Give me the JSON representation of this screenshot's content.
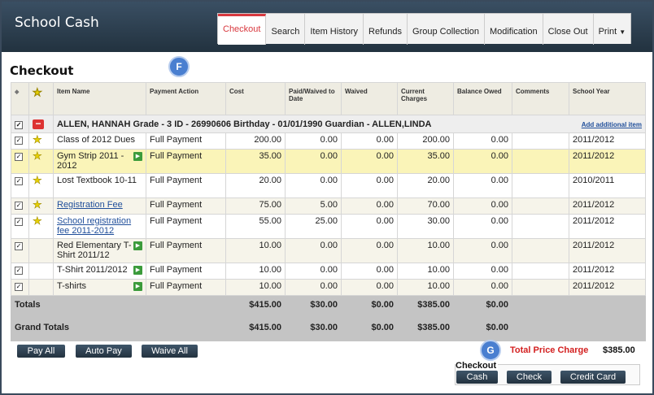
{
  "app": {
    "title": "School Cash"
  },
  "tabs": [
    {
      "label": "Checkout",
      "active": true
    },
    {
      "label": "Search"
    },
    {
      "label": "Item History"
    },
    {
      "label": "Refunds"
    },
    {
      "label": "Group Collection"
    },
    {
      "label": "Modification"
    },
    {
      "label": "Close Out"
    },
    {
      "label": "Print"
    }
  ],
  "page": {
    "title": "Checkout"
  },
  "markers": {
    "f": "F",
    "g": "G"
  },
  "columns": [
    "Item Name",
    "Payment Action",
    "Cost",
    "Paid/Waived to Date",
    "Waived",
    "Current Charges",
    "Balance Owed",
    "Comments",
    "School Year"
  ],
  "student": {
    "label": "ALLEN, HANNAH Grade - 3 ID - 26990606 Birthday - 01/01/1990 Guardian - ALLEN,LINDA",
    "add_link": "Add additional item"
  },
  "rows": [
    {
      "star": true,
      "name": "Class of 2012 Dues",
      "link": false,
      "action": "Full Payment",
      "cost": "200.00",
      "paid": "0.00",
      "waived": "0.00",
      "current": "200.00",
      "balance": "0.00",
      "comments": "",
      "year": "2011/2012"
    },
    {
      "star": true,
      "name": "Gym Strip 2011 - 2012",
      "link": false,
      "action": "Full Payment",
      "cost": "35.00",
      "paid": "0.00",
      "waived": "0.00",
      "current": "35.00",
      "balance": "0.00",
      "comments": "",
      "year": "2011/2012"
    },
    {
      "star": true,
      "name": "Lost Textbook 10-11",
      "link": false,
      "action": "Full Payment",
      "cost": "20.00",
      "paid": "0.00",
      "waived": "0.00",
      "current": "20.00",
      "balance": "0.00",
      "comments": "",
      "year": "2010/2011"
    },
    {
      "star": true,
      "name": "Registration Fee",
      "link": true,
      "action": "Full Payment",
      "cost": "75.00",
      "paid": "5.00",
      "waived": "0.00",
      "current": "70.00",
      "balance": "0.00",
      "comments": "",
      "year": "2011/2012"
    },
    {
      "star": true,
      "name": "School registration fee 2011-2012",
      "link": true,
      "action": "Full Payment",
      "cost": "55.00",
      "paid": "25.00",
      "waived": "0.00",
      "current": "30.00",
      "balance": "0.00",
      "comments": "",
      "year": "2011/2012"
    },
    {
      "star": false,
      "name": "Red Elementary T-Shirt 2011/12",
      "link": false,
      "action": "Full Payment",
      "cost": "10.00",
      "paid": "0.00",
      "waived": "0.00",
      "current": "10.00",
      "balance": "0.00",
      "comments": "",
      "year": "2011/2012"
    },
    {
      "star": false,
      "name": "T-Shirt 2011/2012",
      "link": false,
      "action": "Full Payment",
      "cost": "10.00",
      "paid": "0.00",
      "waived": "0.00",
      "current": "10.00",
      "balance": "0.00",
      "comments": "",
      "year": "2011/2012"
    },
    {
      "star": false,
      "name": "T-shirts",
      "link": false,
      "action": "Full Payment",
      "cost": "10.00",
      "paid": "0.00",
      "waived": "0.00",
      "current": "10.00",
      "balance": "0.00",
      "comments": "",
      "year": "2011/2012"
    }
  ],
  "totals": {
    "label": "Totals",
    "cost": "$415.00",
    "paid": "$30.00",
    "waived": "$0.00",
    "current": "$385.00",
    "balance": "$0.00"
  },
  "grand_totals": {
    "label": "Grand Totals",
    "cost": "$415.00",
    "paid": "$30.00",
    "waived": "$0.00",
    "current": "$385.00",
    "balance": "$0.00"
  },
  "actions": {
    "pay_all": "Pay All",
    "auto_pay": "Auto Pay",
    "waive_all": "Waive All"
  },
  "summary": {
    "total_label": "Total Price Charge",
    "total_value": "$385.00"
  },
  "checkout": {
    "label": "Checkout",
    "cash": "Cash",
    "check": "Check",
    "credit_card": "Credit Card"
  },
  "colors": {
    "accent": "#d8383e",
    "header": "#2c3e50",
    "highlight_row": "#faf4b8",
    "star": "#e6d000"
  }
}
